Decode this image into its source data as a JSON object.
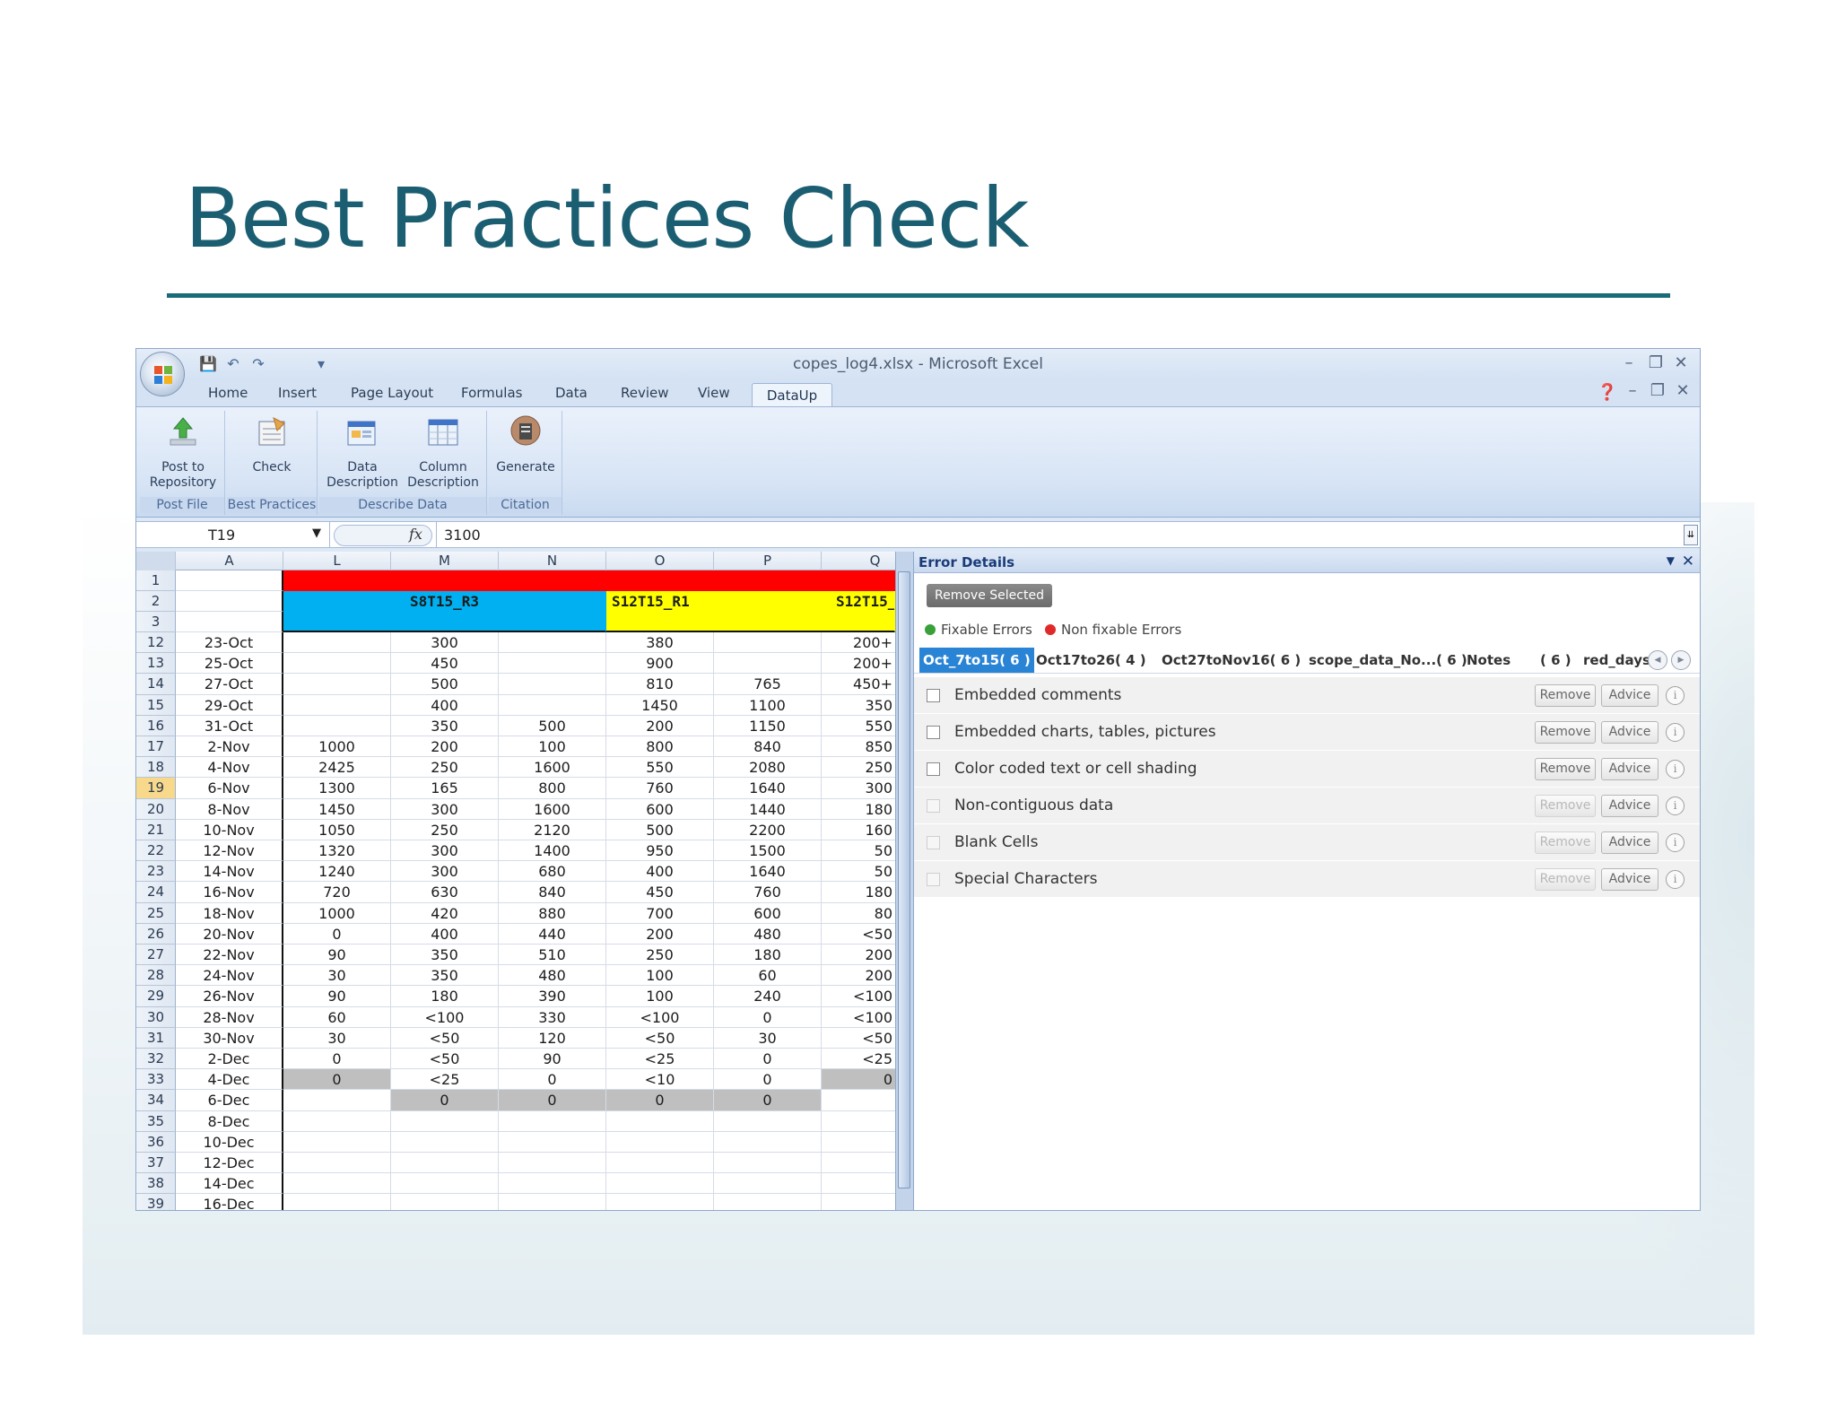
{
  "slide": {
    "title": "Best Practices Check"
  },
  "window": {
    "title": "copes_log4.xlsx - Microsoft Excel"
  },
  "tabs": [
    "Home",
    "Insert",
    "Page Layout",
    "Formulas",
    "Data",
    "Review",
    "View",
    "DataUp"
  ],
  "active_tab": "DataUp",
  "ribbon": {
    "groups": [
      {
        "label": "Post File",
        "buttons": [
          {
            "label": "Post to\nRepository",
            "icon": "upload-arrow-icon"
          }
        ]
      },
      {
        "label": "Best Practices",
        "buttons": [
          {
            "label": "Check",
            "icon": "checklist-icon"
          }
        ]
      },
      {
        "label": "Describe Data",
        "buttons": [
          {
            "label": "Data\nDescription",
            "icon": "data-description-icon"
          },
          {
            "label": "Column\nDescription",
            "icon": "column-description-icon"
          }
        ]
      },
      {
        "label": "Citation",
        "buttons": [
          {
            "label": "Generate",
            "icon": "generate-citation-icon"
          }
        ]
      }
    ]
  },
  "formula_bar": {
    "name_box": "T19",
    "fx": "fx",
    "value": "3100"
  },
  "sheet": {
    "columns": [
      "A",
      "L",
      "M",
      "N",
      "O",
      "P",
      "Q"
    ],
    "header_rows": [
      {
        "row": "1",
        "colors": {
          "bar": "#ff0000"
        }
      },
      {
        "row": "2",
        "labels": [
          "S8T15_R3",
          "S12T15_R1",
          "S12T15_"
        ]
      },
      {
        "row": "3"
      }
    ],
    "colors": {
      "cyan": "#00b0f0",
      "yellow": "#ffff00",
      "red": "#ff0000",
      "gray_cell": "#bfbfbf",
      "selected_row_header": "#f8d88a"
    },
    "selected_row": "19",
    "rows": [
      {
        "n": "12",
        "c": [
          "23-Oct",
          "",
          "300",
          "",
          "380",
          "",
          "200+"
        ]
      },
      {
        "n": "13",
        "c": [
          "25-Oct",
          "",
          "450",
          "",
          "900",
          "",
          "200+"
        ]
      },
      {
        "n": "14",
        "c": [
          "27-Oct",
          "",
          "500",
          "",
          "810",
          "765",
          "450+"
        ]
      },
      {
        "n": "15",
        "c": [
          "29-Oct",
          "",
          "400",
          "",
          "1450",
          "1100",
          "350"
        ]
      },
      {
        "n": "16",
        "c": [
          "31-Oct",
          "",
          "350",
          "500",
          "200",
          "1150",
          "550"
        ]
      },
      {
        "n": "17",
        "c": [
          "2-Nov",
          "1000",
          "200",
          "100",
          "800",
          "840",
          "850"
        ]
      },
      {
        "n": "18",
        "c": [
          "4-Nov",
          "2425",
          "250",
          "1600",
          "550",
          "2080",
          "250"
        ]
      },
      {
        "n": "19",
        "c": [
          "6-Nov",
          "1300",
          "165",
          "800",
          "760",
          "1640",
          "300"
        ]
      },
      {
        "n": "20",
        "c": [
          "8-Nov",
          "1450",
          "300",
          "1600",
          "600",
          "1440",
          "180"
        ]
      },
      {
        "n": "21",
        "c": [
          "10-Nov",
          "1050",
          "250",
          "2120",
          "500",
          "2200",
          "160"
        ]
      },
      {
        "n": "22",
        "c": [
          "12-Nov",
          "1320",
          "300",
          "1400",
          "950",
          "1500",
          "50"
        ]
      },
      {
        "n": "23",
        "c": [
          "14-Nov",
          "1240",
          "300",
          "680",
          "400",
          "1640",
          "50"
        ]
      },
      {
        "n": "24",
        "c": [
          "16-Nov",
          "720",
          "630",
          "840",
          "450",
          "760",
          "180"
        ]
      },
      {
        "n": "25",
        "c": [
          "18-Nov",
          "1000",
          "420",
          "880",
          "700",
          "600",
          "80"
        ]
      },
      {
        "n": "26",
        "c": [
          "20-Nov",
          "0",
          "400",
          "440",
          "200",
          "480",
          "<50"
        ]
      },
      {
        "n": "27",
        "c": [
          "22-Nov",
          "90",
          "350",
          "510",
          "250",
          "180",
          "200"
        ]
      },
      {
        "n": "28",
        "c": [
          "24-Nov",
          "30",
          "350",
          "480",
          "100",
          "60",
          "200"
        ]
      },
      {
        "n": "29",
        "c": [
          "26-Nov",
          "90",
          "180",
          "390",
          "100",
          "240",
          "<100"
        ]
      },
      {
        "n": "30",
        "c": [
          "28-Nov",
          "60",
          "<100",
          "330",
          "<100",
          "0",
          "<100"
        ]
      },
      {
        "n": "31",
        "c": [
          "30-Nov",
          "30",
          "<50",
          "120",
          "<50",
          "30",
          "<50"
        ]
      },
      {
        "n": "32",
        "c": [
          "2-Dec",
          "0",
          "<50",
          "90",
          "<25",
          "0",
          "<25"
        ]
      },
      {
        "n": "33",
        "c": [
          "4-Dec",
          "0",
          "<25",
          "0",
          "<10",
          "0",
          "0"
        ],
        "gray": [
          1,
          6
        ]
      },
      {
        "n": "34",
        "c": [
          "6-Dec",
          "",
          "0",
          "0",
          "0",
          "0",
          ""
        ],
        "gray": [
          2,
          3,
          4,
          5
        ]
      },
      {
        "n": "35",
        "c": [
          "8-Dec",
          "",
          "",
          "",
          "",
          "",
          ""
        ]
      },
      {
        "n": "36",
        "c": [
          "10-Dec",
          "",
          "",
          "",
          "",
          "",
          ""
        ]
      },
      {
        "n": "37",
        "c": [
          "12-Dec",
          "",
          "",
          "",
          "",
          "",
          ""
        ]
      },
      {
        "n": "38",
        "c": [
          "14-Dec",
          "",
          "",
          "",
          "",
          "",
          ""
        ]
      },
      {
        "n": "39",
        "c": [
          "16-Dec",
          "",
          "",
          "",
          "",
          "",
          ""
        ]
      }
    ]
  },
  "error_panel": {
    "title": "Error Details",
    "remove_selected": "Remove Selected",
    "legend": [
      {
        "label": "Fixable Errors",
        "color": "#3aa13a"
      },
      {
        "label": "Non fixable Errors",
        "color": "#e02a2a"
      }
    ],
    "sheet_tabs": [
      "Oct_7to15( 6 )",
      "Oct17to26( 4 )",
      "Oct27toNov16( 6 )",
      "scope_data_No...( 6 )",
      "Notes",
      "( 6 )",
      "red_days"
    ],
    "active_sheet_tab": "Oct_7to15( 6 )",
    "errors": [
      {
        "label": "Embedded comments",
        "remove": "Remove",
        "advice": "Advice",
        "enabled": true
      },
      {
        "label": "Embedded charts, tables, pictures",
        "remove": "Remove",
        "advice": "Advice",
        "enabled": true
      },
      {
        "label": "Color coded text or cell shading",
        "remove": "Remove",
        "advice": "Advice",
        "enabled": true
      },
      {
        "label": "Non-contiguous data",
        "remove": "Remove",
        "advice": "Advice",
        "enabled": false
      },
      {
        "label": "Blank Cells",
        "remove": "Remove",
        "advice": "Advice",
        "enabled": false
      },
      {
        "label": "Special Characters",
        "remove": "Remove",
        "advice": "Advice",
        "enabled": false
      }
    ]
  }
}
